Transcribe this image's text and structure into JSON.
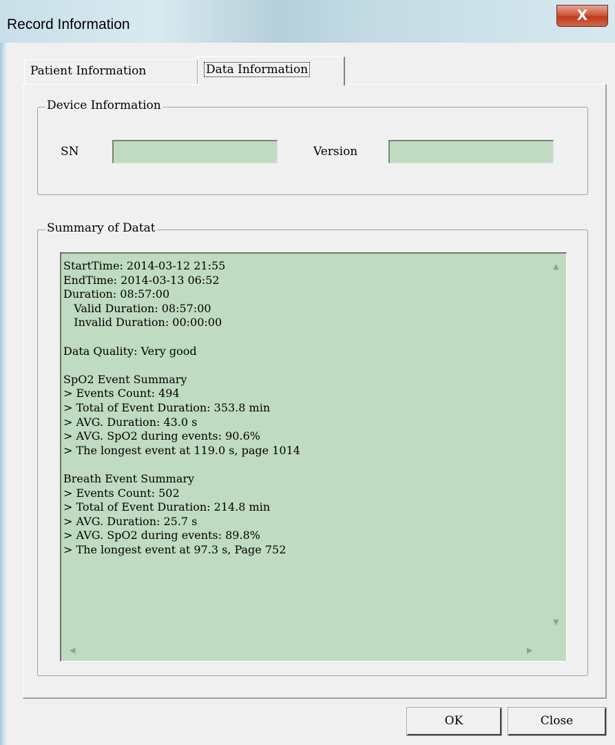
{
  "window": {
    "title": "Record Information",
    "close_glyph": "X"
  },
  "tabs": [
    {
      "label": "Patient Information",
      "active": false
    },
    {
      "label": "Data Information",
      "active": true
    }
  ],
  "device_info": {
    "group_label": "Device Information",
    "sn_label": "SN",
    "sn_value": "",
    "version_label": "Version",
    "version_value": ""
  },
  "summary": {
    "group_label": "Summary of Datat",
    "text": "StartTime: 2014-03-12 21:55\nEndTime: 2014-03-13 06:52\nDuration: 08:57:00\n   Valid Duration: 08:57:00\n   Invalid Duration: 00:00:00\n\nData Quality: Very good\n\nSpO2 Event Summary\n> Events Count: 494\n> Total of Event Duration: 353.8 min\n> AVG. Duration: 43.0 s\n> AVG. SpO2 during events: 90.6%\n> The longest event at 119.0 s, page 1014\n\nBreath Event Summary\n> Events Count: 502\n> Total of Event Duration: 214.8 min\n> AVG. Duration: 25.7 s\n> AVG. SpO2 during events: 89.8%\n> The longest event at 97.3 s, Page 752"
  },
  "buttons": {
    "ok_label": "OK",
    "close_label": "Close"
  },
  "colors": {
    "field_bg": "#bfdbc1",
    "window_bg": "#f0f0f0",
    "close_btn": "#c7462b"
  },
  "icons": {
    "scroll_up": "scroll-up-arrow-icon",
    "scroll_down": "scroll-down-arrow-icon",
    "scroll_left": "scroll-left-arrow-icon",
    "scroll_right": "scroll-right-arrow-icon"
  }
}
